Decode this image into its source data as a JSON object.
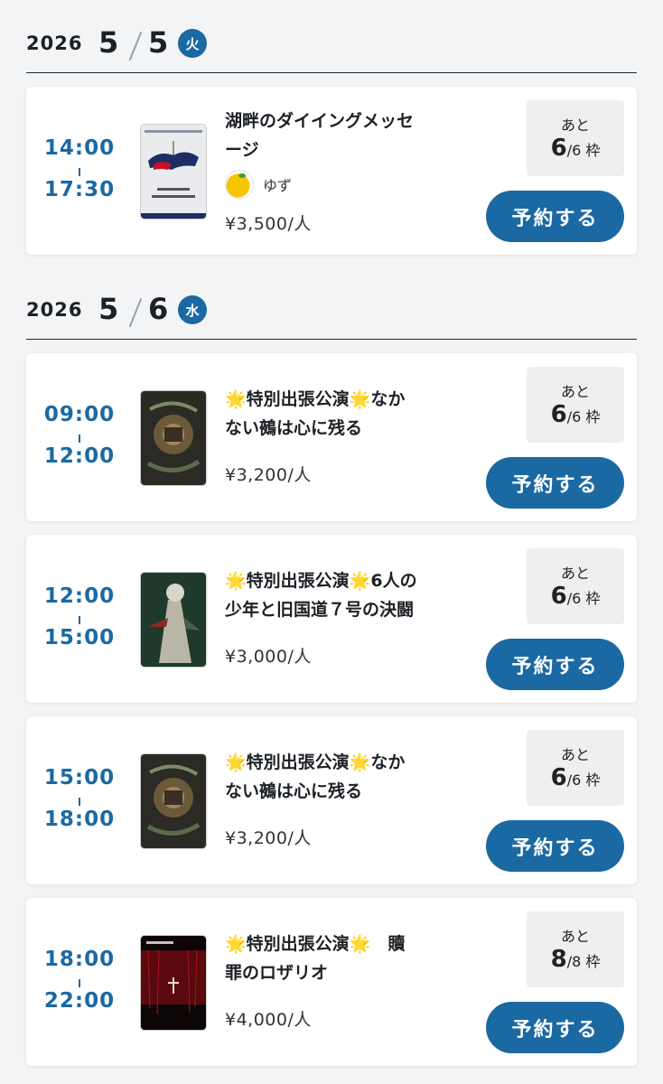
{
  "days": [
    {
      "year": "2026",
      "month": "5",
      "day": "5",
      "weekday": "火"
    },
    {
      "year": "2026",
      "month": "5",
      "day": "6",
      "weekday": "水"
    }
  ],
  "events": [
    {
      "start": "14:00",
      "end": "17:30",
      "title_line1": "湖畔のダイイングメッセ",
      "title_line2": "ージ",
      "author": "ゆず",
      "price": "¥3,500/人",
      "remaining_label": "あと",
      "remaining": "6",
      "capacity": "/6 枠",
      "button": "予約する",
      "poster": "poster-lakeside"
    },
    {
      "start": "09:00",
      "end": "12:00",
      "star": "🌟",
      "title_a": "特別出張公演",
      "title_b": "なか",
      "title_line2": "ない鵺は心に残る",
      "price": "¥3,200/人",
      "remaining_label": "あと",
      "remaining": "6",
      "capacity": "/6 枠",
      "button": "予約する",
      "poster": "poster-nue"
    },
    {
      "start": "12:00",
      "end": "15:00",
      "star": "🌟",
      "title_a": "特別出張公演",
      "title_b": "6人の",
      "title_line2": "少年と旧国道７号の決闘",
      "price": "¥3,000/人",
      "remaining_label": "あと",
      "remaining": "6",
      "capacity": "/6 枠",
      "button": "予約する",
      "poster": "poster-route7"
    },
    {
      "start": "15:00",
      "end": "18:00",
      "star": "🌟",
      "title_a": "特別出張公演",
      "title_b": "なか",
      "title_line2": "ない鵺は心に残る",
      "price": "¥3,200/人",
      "remaining_label": "あと",
      "remaining": "6",
      "capacity": "/6 枠",
      "button": "予約する",
      "poster": "poster-nue"
    },
    {
      "start": "18:00",
      "end": "22:00",
      "star": "🌟",
      "title_a": "特別出張公演",
      "title_b": "　贖",
      "title_line2": "罪のロザリオ",
      "price": "¥4,000/人",
      "remaining_label": "あと",
      "remaining": "8",
      "capacity": "/8 枠",
      "button": "予約する",
      "poster": "poster-rosario"
    }
  ],
  "colors": {
    "accent": "#1b69a3",
    "star": "#f6b51e",
    "background": "#f3f4f5"
  }
}
